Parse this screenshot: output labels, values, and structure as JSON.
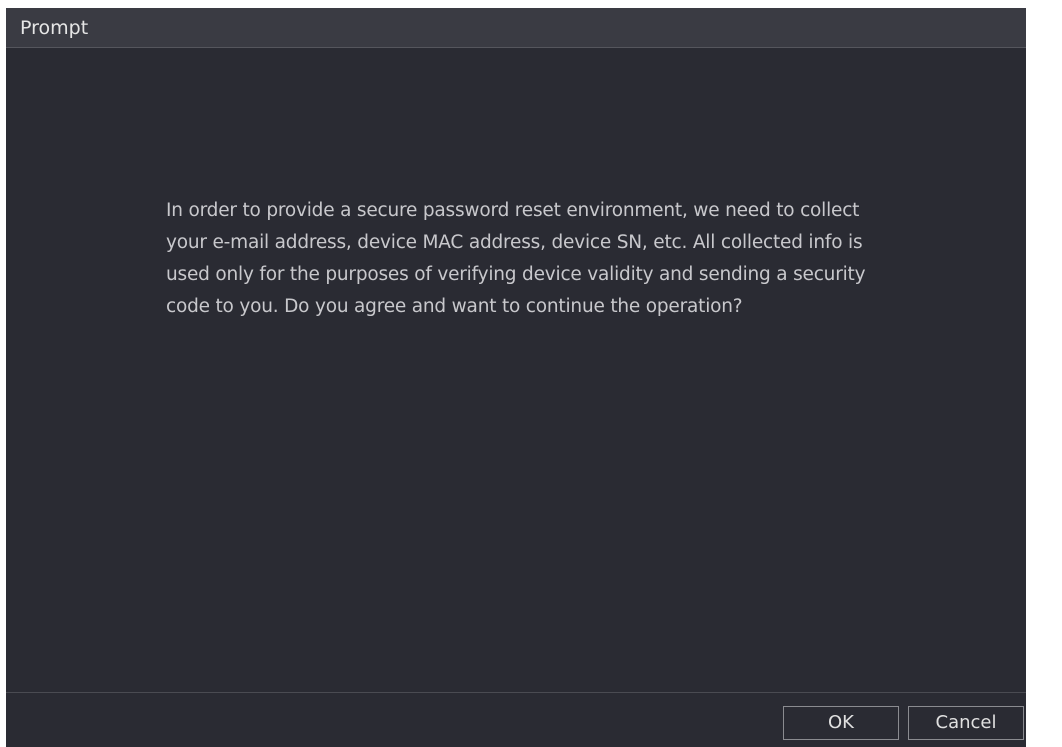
{
  "dialog": {
    "title": "Prompt",
    "message": "In order to provide a secure password reset environment, we need to collect your e-mail address, device MAC address, device SN, etc. All collected info is used only for the purposes of verifying device validity and sending a security code to you. Do you agree and want to continue the operation?",
    "ok_label": "OK",
    "cancel_label": "Cancel"
  },
  "colors": {
    "background": "#2a2b33",
    "title_bar": "#3a3b43",
    "text": "#c8c8cc",
    "button_border": "#8a8b90"
  }
}
